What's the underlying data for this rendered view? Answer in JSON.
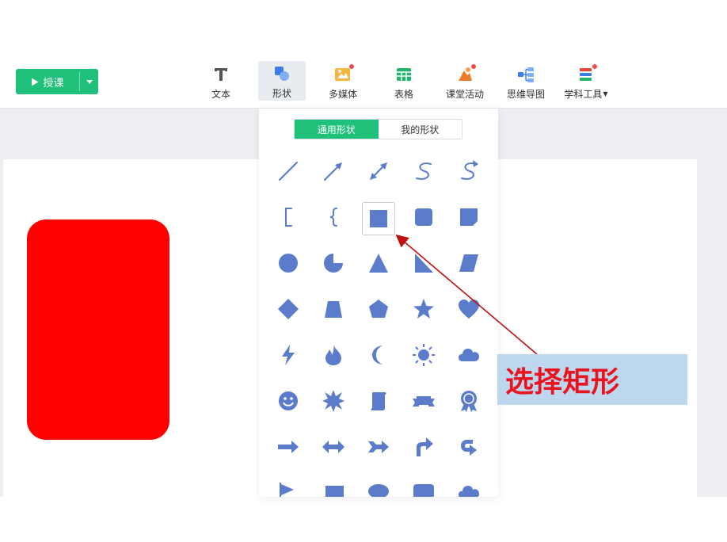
{
  "toolbar": {
    "teach_label": "授课",
    "tools": [
      {
        "id": "text",
        "label": "文本",
        "icon": "text-icon"
      },
      {
        "id": "shape",
        "label": "形状",
        "icon": "shape-icon",
        "active": true
      },
      {
        "id": "media",
        "label": "多媒体",
        "icon": "multimedia-icon",
        "dot": true
      },
      {
        "id": "table",
        "label": "表格",
        "icon": "table-icon"
      },
      {
        "id": "activity",
        "label": "课堂活动",
        "icon": "classroom-activity-icon",
        "dot": true
      },
      {
        "id": "mindmap",
        "label": "思维导图",
        "icon": "mindmap-icon"
      },
      {
        "id": "subject",
        "label": "学科工具",
        "icon": "subject-tools-icon",
        "dot": true
      }
    ]
  },
  "shape_panel": {
    "tabs": [
      "通用形状",
      "我的形状"
    ],
    "active_tab": 0,
    "selected_shape": "rectangle",
    "shape_color": "#5b7ccb",
    "shapes": [
      "line",
      "arrow-line",
      "double-arrow-line",
      "curve",
      "curve-arrow",
      "bracket",
      "brace",
      "rectangle",
      "rounded-rectangle",
      "snip-rectangle",
      "circle",
      "pie",
      "triangle",
      "right-triangle",
      "parallelogram",
      "diamond",
      "trapezoid",
      "pentagon",
      "star",
      "heart",
      "lightning",
      "flame",
      "moon",
      "sun",
      "cloud",
      "smiley",
      "explosion",
      "scroll",
      "banner",
      "ribbon-badge",
      "right-arrow",
      "left-right-arrow",
      "notched-arrow",
      "bent-arrow",
      "u-turn-arrow",
      "flag",
      "callout-rect",
      "callout-oval",
      "callout-rounded",
      "callout-cloud"
    ]
  },
  "annotation": {
    "text": "选择矩形",
    "text_color": "#e8141e",
    "bg_color": "#bdd7ee"
  },
  "canvas": {
    "shape_fill": "#ff0000"
  },
  "colors": {
    "accent": "#1fc07a"
  }
}
